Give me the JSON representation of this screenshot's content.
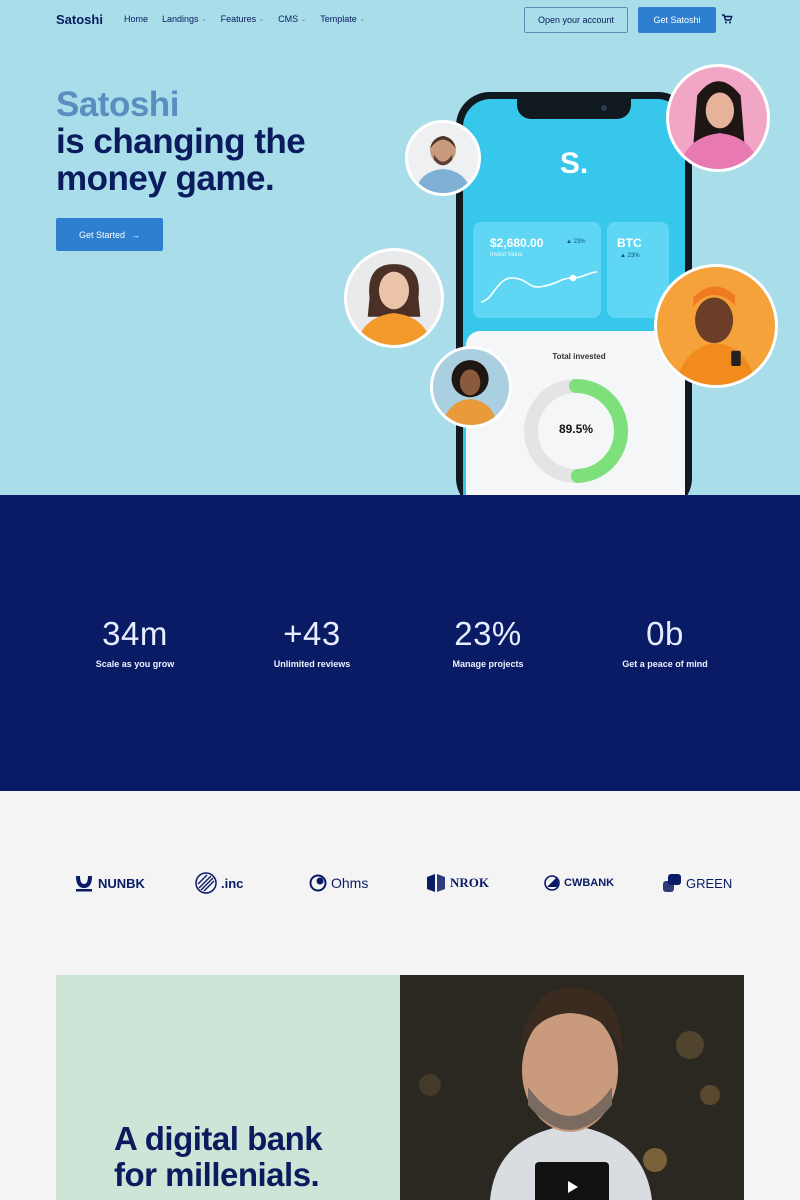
{
  "nav": {
    "brand": "Satoshi",
    "items": [
      {
        "label": "Home",
        "dropdown": false
      },
      {
        "label": "Landings",
        "dropdown": true
      },
      {
        "label": "Features",
        "dropdown": true
      },
      {
        "label": "CMS",
        "dropdown": true
      },
      {
        "label": "Template",
        "dropdown": true
      }
    ],
    "open_account": "Open your account",
    "get_satoshi": "Get Satoshi"
  },
  "hero": {
    "brand_word": "Satoshi",
    "line2": "is changing the",
    "line3": "money game.",
    "cta": "Get Started"
  },
  "phone": {
    "logo": "S.",
    "invest_value": "$2,680.00",
    "invest_label": "Invest Value",
    "invest_pct": "23%",
    "btc_label": "BTC",
    "btc_pct": "23%",
    "total_invested_label": "Total invested",
    "donut_value": "89.5%",
    "donut_fraction": 0.895
  },
  "stats": [
    {
      "value": "34m",
      "label": "Scale as you grow"
    },
    {
      "value": "+43",
      "label": "Unlimited reviews"
    },
    {
      "value": "23%",
      "label": "Manage projects"
    },
    {
      "value": "0b",
      "label": "Get a peace of mind"
    }
  ],
  "logos": [
    "NUNBK",
    ".inc",
    "Ohms",
    "NROK",
    "CWBANK",
    "GREEN"
  ],
  "feature": {
    "line1": "A digital bank",
    "line2": "for millenials."
  },
  "colors": {
    "hero_bg": "#a8dde9",
    "navy": "#0a1b66",
    "accent_blue": "#2f7fd0",
    "phone_screen": "#37c7ea",
    "donut_green": "#7ee07a",
    "feature_green": "#cde5d6"
  }
}
